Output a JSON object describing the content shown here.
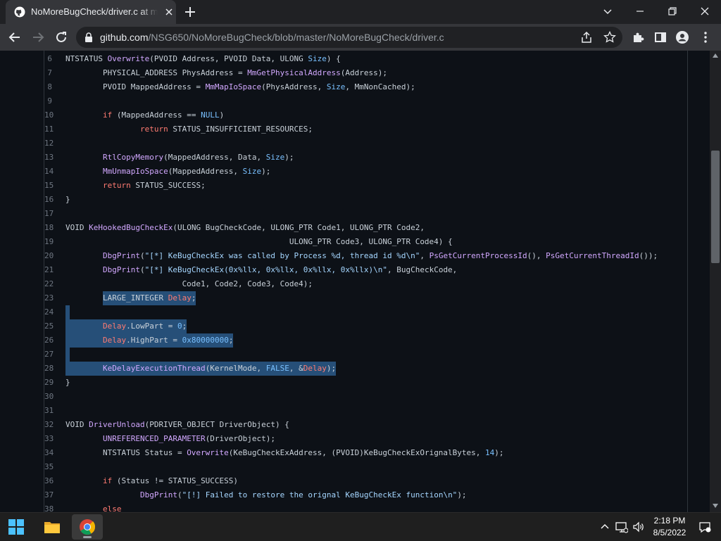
{
  "browser": {
    "tab_title": "NoMoreBugCheck/driver.c at ma",
    "url_host": "github.com",
    "url_path": "/NSG650/NoMoreBugCheck/blob/master/NoMoreBugCheck/driver.c"
  },
  "colors": {
    "keyword": "#ff7b72",
    "function": "#d2a8ff",
    "constant": "#79c0ff",
    "string": "#a5d6ff",
    "variable": "#ffa657",
    "selection": "#264f78"
  },
  "code": {
    "lines": [
      {
        "n": "6",
        "t": "NTSTATUS Overwrite(PVOID Address, PVOID Data, ULONG Size) {"
      },
      {
        "n": "7",
        "t": "        PHYSICAL_ADDRESS PhysAddress = MmGetPhysicalAddress(Address);"
      },
      {
        "n": "8",
        "t": "        PVOID MappedAddress = MmMapIoSpace(PhysAddress, Size, MmNonCached);"
      },
      {
        "n": "9",
        "t": ""
      },
      {
        "n": "10",
        "t": "        if (MappedAddress == NULL)"
      },
      {
        "n": "11",
        "t": "                return STATUS_INSUFFICIENT_RESOURCES;"
      },
      {
        "n": "12",
        "t": ""
      },
      {
        "n": "13",
        "t": "        RtlCopyMemory(MappedAddress, Data, Size);"
      },
      {
        "n": "14",
        "t": "        MmUnmapIoSpace(MappedAddress, Size);"
      },
      {
        "n": "15",
        "t": "        return STATUS_SUCCESS;"
      },
      {
        "n": "16",
        "t": "}"
      },
      {
        "n": "17",
        "t": ""
      },
      {
        "n": "18",
        "t": "VOID KeHookedBugCheckEx(ULONG BugCheckCode, ULONG_PTR Code1, ULONG_PTR Code2,"
      },
      {
        "n": "19",
        "t": "                                                ULONG_PTR Code3, ULONG_PTR Code4) {"
      },
      {
        "n": "20",
        "t": "        DbgPrint(\"[*] KeBugCheckEx was called by Process %d, thread id %d\\n\", PsGetCurrentProcessId(), PsGetCurrentThreadId());"
      },
      {
        "n": "21",
        "t": "        DbgPrint(\"[*] KeBugCheckEx(0x%llx, 0x%llx, 0x%llx, 0x%llx)\\n\", BugCheckCode,"
      },
      {
        "n": "22",
        "t": "                         Code1, Code2, Code3, Code4);"
      },
      {
        "n": "23",
        "t": "        LARGE_INTEGER Delay;"
      },
      {
        "n": "24",
        "t": ""
      },
      {
        "n": "25",
        "t": "        Delay.LowPart = 0;"
      },
      {
        "n": "26",
        "t": "        Delay.HighPart = 0x80000000;"
      },
      {
        "n": "27",
        "t": ""
      },
      {
        "n": "28",
        "t": "        KeDelayExecutionThread(KernelMode, FALSE, &Delay);"
      },
      {
        "n": "29",
        "t": "}"
      },
      {
        "n": "30",
        "t": ""
      },
      {
        "n": "31",
        "t": ""
      },
      {
        "n": "32",
        "t": "VOID DriverUnload(PDRIVER_OBJECT DriverObject) {"
      },
      {
        "n": "33",
        "t": "        UNREFERENCED_PARAMETER(DriverObject);"
      },
      {
        "n": "34",
        "t": "        NTSTATUS Status = Overwrite(KeBugCheckExAddress, (PVOID)KeBugCheckExOrignalBytes, 14);"
      },
      {
        "n": "35",
        "t": ""
      },
      {
        "n": "36",
        "t": "        if (Status != STATUS_SUCCESS)"
      },
      {
        "n": "37",
        "t": "                DbgPrint(\"[!] Failed to restore the orignal KeBugCheckEx function\\n\");"
      },
      {
        "n": "38",
        "t": "        else"
      }
    ],
    "selected_line_numbers": [
      "23",
      "24",
      "25",
      "26",
      "27",
      "28"
    ]
  },
  "taskbar": {
    "time": "2:18 PM",
    "date": "8/5/2022"
  }
}
